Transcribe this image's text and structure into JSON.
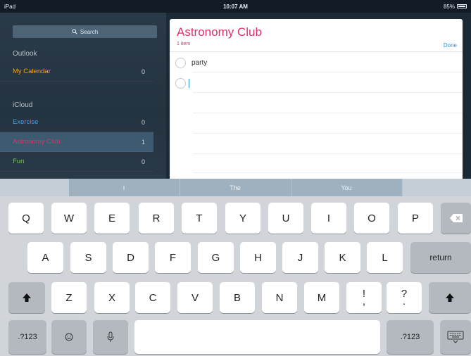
{
  "status_bar": {
    "device": "iPad",
    "time": "10:07 AM",
    "battery": "85%"
  },
  "sidebar": {
    "search_label": "Search",
    "sections": [
      {
        "header": "Outlook"
      },
      {
        "header": "iCloud"
      }
    ],
    "lists": [
      {
        "name": "My Calendar",
        "count": "0",
        "color": "#f4a300"
      },
      {
        "name": "Exercise",
        "count": "0",
        "color": "#37a7e6"
      },
      {
        "name": "Astronomy Club",
        "count": "1",
        "color": "#e0306e"
      },
      {
        "name": "Fun",
        "count": "0",
        "color": "#6fd13a"
      }
    ]
  },
  "list_panel": {
    "title": "Astronomy Club",
    "item_count": "1 item",
    "done_label": "Done",
    "items": [
      "party",
      ""
    ]
  },
  "keyboard": {
    "predictions": [
      "I",
      "The",
      "You"
    ],
    "row1": [
      "Q",
      "W",
      "E",
      "R",
      "T",
      "Y",
      "U",
      "I",
      "O",
      "P"
    ],
    "row2": [
      "A",
      "S",
      "D",
      "F",
      "G",
      "H",
      "J",
      "K",
      "L"
    ],
    "row3": [
      "Z",
      "X",
      "C",
      "V",
      "B",
      "N",
      "M"
    ],
    "punct1": {
      "top": "!",
      "bottom": ","
    },
    "punct2": {
      "top": "?",
      "bottom": "."
    },
    "return_label": "return",
    "numbers_label": ".?123",
    "numbers_label_right": ".?123",
    "icons": [
      "delete-icon",
      "shift-icon",
      "emoji-icon",
      "microphone-icon",
      "keyboard-hide-icon"
    ]
  }
}
